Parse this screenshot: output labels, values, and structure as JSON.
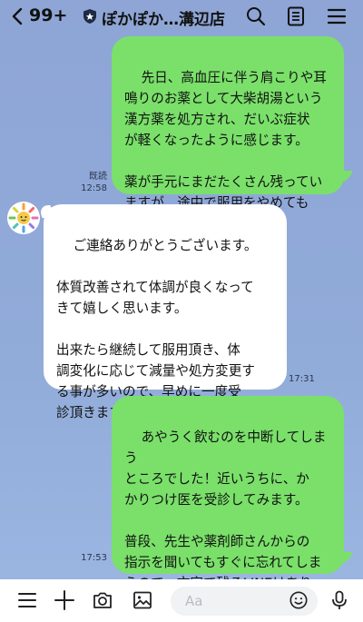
{
  "header": {
    "back_count": "99+",
    "title": "ぽかぽか…溝辺店"
  },
  "messages": [
    {
      "direction": "outgoing",
      "text": "先日、高血圧に伴う肩こりや耳\n鳴りのお薬として大柴胡湯という\n漢方薬を処方され、だいぶ症状\nが軽くなったように感じます。\n\n薬が手元にまだたくさん残ってい\nますが、途中で服用をやめても\n問題ないでしょうか。",
      "read_label": "既読",
      "time": "12:58"
    },
    {
      "direction": "incoming",
      "text": "ご連絡ありがとうございます。\n\n体質改善されて体調が良くなって\nきて嬉しく思います。\n\n出来たら継続して服用頂き、体\n調変化に応じて減量や処方変更す\nる事が多いので、早めに一度受\n診頂きますと幸いです。",
      "time": "17:31"
    },
    {
      "direction": "outgoing",
      "text": "あやうく飲むのを中断してしまう\nところでした！近いうちに、か\nかりつけ医を受診してみます。\n\n普段、先生や薬剤師さんからの\n指示を聞いてもすぐに忘れてしま\nうので、文字で残るLINEはあり\nがたいです",
      "emoji": "sweat-smile-emoji",
      "time": "17:53"
    }
  ],
  "composer": {
    "placeholder": "Aa"
  },
  "icons": {
    "back": "chevron-left-icon",
    "verified": "shield-icon",
    "search": "search-icon",
    "notes": "note-icon",
    "menu": "menu-icon",
    "plus": "plus-icon",
    "camera": "camera-icon",
    "image": "image-icon",
    "emoji": "emoji-icon",
    "mic": "mic-icon"
  },
  "colors": {
    "background": "#8ea6d6",
    "outgoing_bubble": "#7ae06a",
    "incoming_bubble": "#ffffff"
  }
}
